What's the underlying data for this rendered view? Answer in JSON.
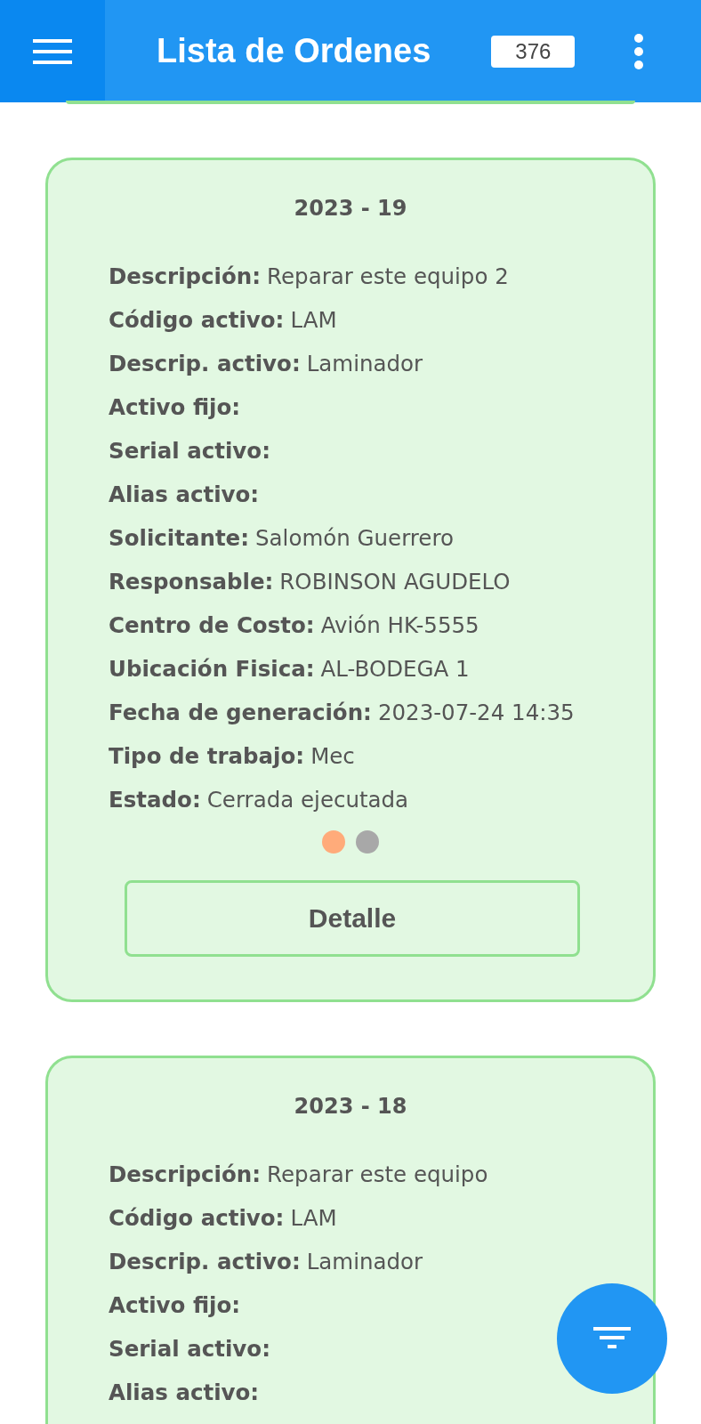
{
  "app_bar": {
    "title": "Lista de Ordenes",
    "count": "376"
  },
  "orders": [
    {
      "number": "2023 - 19",
      "fields": [
        {
          "label": "Descripción:",
          "value": "Reparar este equipo 2"
        },
        {
          "label": "Código activo:",
          "value": "LAM"
        },
        {
          "label": "Descrip. activo:",
          "value": "Laminador"
        },
        {
          "label": "Activo fijo:"
        },
        {
          "label": "Serial activo:"
        },
        {
          "label": "Alias activo:"
        },
        {
          "label": "Solicitante:",
          "value": "Salomón Guerrero"
        },
        {
          "label": "Responsable:",
          "value": "ROBINSON AGUDELO"
        },
        {
          "label": "Centro de Costo:",
          "value": "Avión HK-5555"
        },
        {
          "label": "Ubicación Fisica:",
          "value": "AL-BODEGA 1"
        },
        {
          "label": "Fecha de generación:",
          "value": "2023-07-24 14:35"
        },
        {
          "label": "Tipo de trabajo:",
          "value": "Mec"
        },
        {
          "label": "Estado:",
          "value": "Cerrada ejecutada"
        }
      ],
      "indicators": [
        {
          "color": "#ffab7a"
        },
        {
          "color": "#a8a8a8"
        }
      ],
      "button": "Detalle"
    },
    {
      "number": "2023 - 18",
      "fields": [
        {
          "label": "Descripción:",
          "value": "Reparar este equipo"
        },
        {
          "label": "Código activo:",
          "value": "LAM"
        },
        {
          "label": "Descrip. activo:",
          "value": "Laminador"
        },
        {
          "label": "Activo fijo:"
        },
        {
          "label": "Serial activo:"
        },
        {
          "label": "Alias activo:"
        }
      ]
    }
  ]
}
